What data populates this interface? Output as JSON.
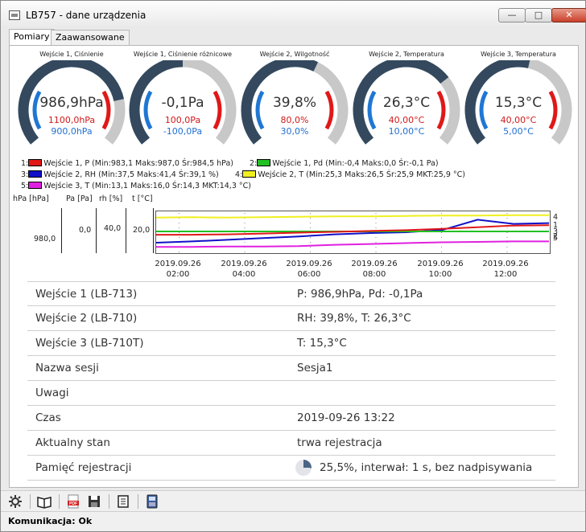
{
  "window": {
    "title": "LB757 - dane urządzenia",
    "minimize_icon": "minimize-icon",
    "maximize_icon": "maximize-icon",
    "close_icon": "close-icon"
  },
  "tabs": [
    {
      "label": "Pomiary",
      "active": true
    },
    {
      "label": "Zaawansowane",
      "active": false
    }
  ],
  "colors": {
    "gauge_dark": "#34495e",
    "gauge_light": "#c8c8c8",
    "gauge_blue": "#1f77d4",
    "gauge_red": "#e01818",
    "series_1": "#e01818",
    "series_2": "#22c022",
    "series_3": "#1010c8",
    "series_4": "#f0f020",
    "series_5": "#e020e0"
  },
  "gauges": [
    {
      "label": "Wejście 1, Ciśnienie",
      "value": "986,9hPa",
      "max": "1100,0hPa",
      "min": "900,0hPa",
      "fraction": 0.8
    },
    {
      "label": "Wejście 1, Ciśnienie różnicowe",
      "value": "-0,1Pa",
      "max": "100,0Pa",
      "min": "-100,0Pa",
      "fraction": 0.5
    },
    {
      "label": "Wejście 2, Wilgotność",
      "value": "39,8%",
      "max": "80,0%",
      "min": "30,0%",
      "fraction": 0.6
    },
    {
      "label": "Wejście 2, Temperatura",
      "value": "26,3°C",
      "max": "40,00°C",
      "min": "10,00°C",
      "fraction": 0.7
    },
    {
      "label": "Wejście 3, Temperatura",
      "value": "15,3°C",
      "max": "40,00°C",
      "min": "5,00°C",
      "fraction": 0.55
    }
  ],
  "legend": [
    {
      "num": "1:",
      "text": "Wejście 1, P (Min:983,1 Maks:987,0 Śr:984,5 hPa)",
      "color": "#e01818"
    },
    {
      "num": "2:",
      "text": "Wejście 1, Pd (Min:-0,4 Maks:0,0 Śr:-0,1 Pa)",
      "color": "#22c022"
    },
    {
      "num": "3:",
      "text": "Wejście 2, RH (Min:37,5 Maks:41,4 Śr:39,1 %)",
      "color": "#1010c8"
    },
    {
      "num": "4:",
      "text": "Wejście 2, T (Min:25,3 Maks:26,5 Śr:25,9 MKT:25,9 °C)",
      "color": "#f0f020"
    },
    {
      "num": "5:",
      "text": "Wejście 3, T (Min:13,1 Maks:16,0 Śr:14,3 MKT:14,3 °C)",
      "color": "#e020e0"
    }
  ],
  "chart_data": {
    "type": "line",
    "axis_units": [
      "hPa [hPa]",
      "Pa [Pa]",
      "rh [%]",
      "t [°C]"
    ],
    "axis_ticks": [
      "980,0",
      "0,0",
      "40,0",
      "20,0"
    ],
    "x_labels": [
      {
        "date": "2019.09.26",
        "time": "02:00"
      },
      {
        "date": "2019.09.26",
        "time": "04:00"
      },
      {
        "date": "2019.09.26",
        "time": "06:00"
      },
      {
        "date": "2019.09.26",
        "time": "08:00"
      },
      {
        "date": "2019.09.26",
        "time": "10:00"
      },
      {
        "date": "2019.09.26",
        "time": "12:00"
      }
    ],
    "series_end_labels": [
      "4",
      "1",
      "3",
      "2",
      "5"
    ],
    "series": [
      {
        "id": "4",
        "color": "#f0f020",
        "values": [
          0.15,
          0.14,
          0.15,
          0.14,
          0.13,
          0.12,
          0.12,
          0.11,
          0.1,
          0.1,
          0.09,
          0.09
        ]
      },
      {
        "id": "3",
        "color": "#1010c8",
        "values": [
          0.75,
          0.72,
          0.68,
          0.64,
          0.6,
          0.55,
          0.52,
          0.5,
          0.45,
          0.2,
          0.3,
          0.28
        ]
      },
      {
        "id": "2",
        "color": "#22c022",
        "values": [
          0.48,
          0.48,
          0.48,
          0.48,
          0.48,
          0.48,
          0.48,
          0.48,
          0.48,
          0.48,
          0.48,
          0.48
        ]
      },
      {
        "id": "1",
        "color": "#e01818",
        "values": [
          0.56,
          0.56,
          0.55,
          0.53,
          0.51,
          0.49,
          0.47,
          0.45,
          0.42,
          0.38,
          0.34,
          0.33
        ]
      },
      {
        "id": "5",
        "color": "#e020e0",
        "values": [
          0.85,
          0.85,
          0.84,
          0.84,
          0.83,
          0.8,
          0.78,
          0.76,
          0.74,
          0.73,
          0.72,
          0.72
        ]
      }
    ]
  },
  "info_rows": [
    {
      "key": "Wejście 1 (LB-713)",
      "value": "P: 986,9hPa, Pd: -0,1Pa"
    },
    {
      "key": "Wejście 2 (LB-710)",
      "value": "RH: 39,8%, T: 26,3°C"
    },
    {
      "key": "Wejście 3 (LB-710T)",
      "value": "T: 15,3°C"
    },
    {
      "key": "Nazwa sesji",
      "value": "Sesja1"
    },
    {
      "key": "Uwagi",
      "value": ""
    },
    {
      "key": "Czas",
      "value": "2019-09-26 13:22"
    },
    {
      "key": "Aktualny stan",
      "value": "trwa rejestracja"
    },
    {
      "key": "Pamięć rejestracji",
      "value": "25,5%, interwał: 1 s, bez nadpisywania",
      "fill": 0.255
    }
  ],
  "toolbar": {
    "icons": [
      "settings-icon",
      "book-icon",
      "pdf-icon",
      "save-icon",
      "document-icon",
      "device-icon"
    ]
  },
  "status": {
    "text": "Komunikacja: Ok"
  }
}
